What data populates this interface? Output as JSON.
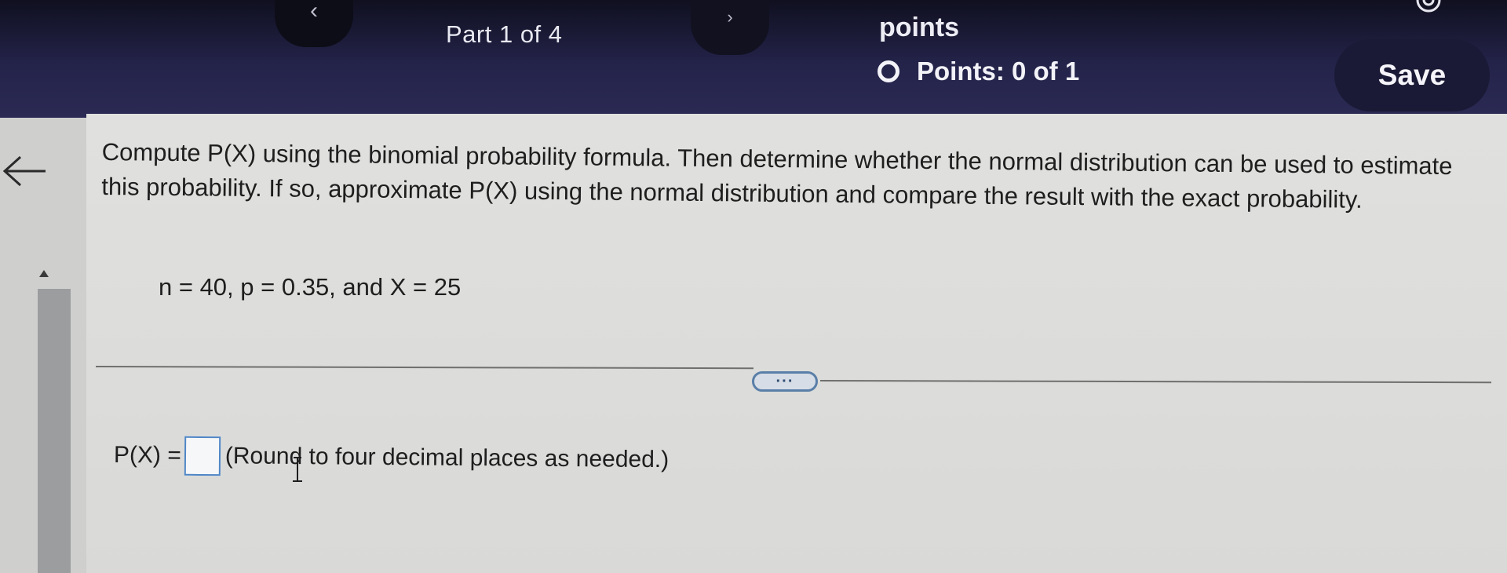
{
  "header": {
    "prev_arrow": "‹",
    "next_arrow": "›",
    "part_label": "Part 1 of 4",
    "points_label": "points",
    "points_score": "Points: 0 of 1",
    "save_label": "Save"
  },
  "question": {
    "instruction": "Compute P(X) using the binomial probability formula. Then determine whether the normal distribution can be used to estimate this probability. If so, approximate P(X) using the normal distribution and compare the result with the exact probability.",
    "given": "n = 40, p = 0.35, and X = 25",
    "more_label": "···"
  },
  "answer": {
    "label": "P(X) =",
    "input_value": "",
    "hint": "(Round to four decimal places as needed.)"
  },
  "icons": [
    "settings-icon",
    "back-arrow-icon",
    "status-circle-icon",
    "scroll-up-icon",
    "text-cursor-icon"
  ],
  "colors": {
    "header_bg": "#24234a",
    "content_bg": "#dcdddb",
    "input_border": "#4f86c6",
    "more_button_border": "#5a7fa8"
  }
}
